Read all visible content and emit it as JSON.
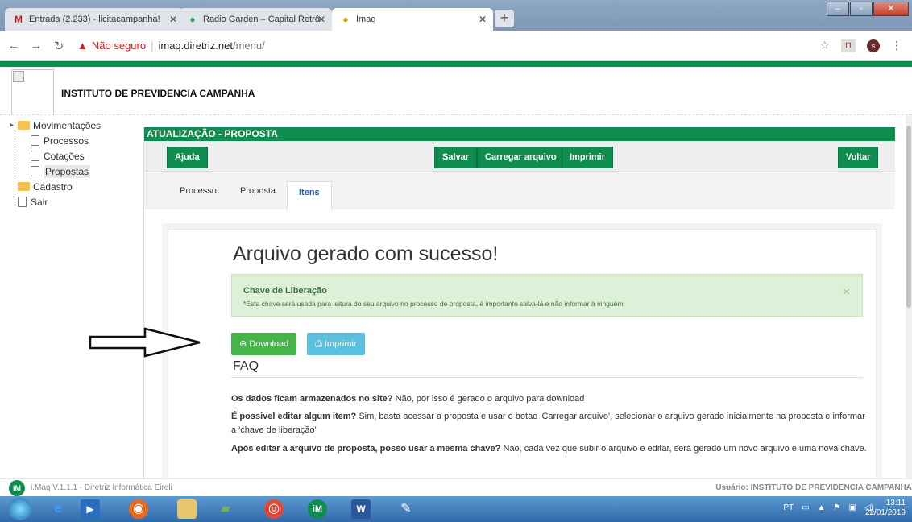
{
  "browser": {
    "tabs": [
      {
        "label": "Entrada (2.233) - licitacampanha!",
        "icon": "gmail-icon"
      },
      {
        "label": "Radio Garden – Capital Retrô",
        "icon": "radio-icon"
      },
      {
        "label": "Imaq",
        "icon": "site-icon"
      }
    ],
    "security_label": "Não seguro",
    "url_host": "imaq.diretriz.net",
    "url_path": "/menu/"
  },
  "header": {
    "institute": "INSTITUTO DE PREVIDENCIA CAMPANHA"
  },
  "tree": {
    "movimentacoes": "Movimentações",
    "processos": "Processos",
    "cotacoes": "Cotações",
    "propostas": "Propostas",
    "cadastro": "Cadastro",
    "sair": "Sair"
  },
  "panel": {
    "title": "ATUALIZAÇÃO - PROPOSTA",
    "buttons": {
      "ajuda": "Ajuda",
      "salvar": "Salvar",
      "carregar": "Carregar arquivo",
      "imprimir": "Imprimir",
      "voltar": "Voltar"
    },
    "tabs": [
      "Processo",
      "Proposta",
      "Itens"
    ]
  },
  "content": {
    "success": "Arquivo gerado com sucesso!",
    "alert_title": "Chave de Liberação",
    "alert_text": "*Esta chave será usada para leitura do seu arquivo no processo de proposta, é importante salva-lá e não informar à ninguém",
    "download": "Download",
    "print": "Imprimir",
    "faq_title": "FAQ",
    "faq": [
      {
        "q": "Os dados ficam armazenados no site?",
        "a": " Não, por isso é gerado o arquivo para download"
      },
      {
        "q": "É possivel editar algum item?",
        "a": " Sim, basta acessar a proposta e usar o botao 'Carregar arquivo', selecionar o arquivo gerado inicialmente na proposta e informar a 'chave de liberação'"
      },
      {
        "q": "Após editar a arquivo de proposta, posso usar a mesma chave?",
        "a": " Não, cada vez que subir o arquivo e editar, será gerado um novo arquivo e uma nova chave."
      }
    ]
  },
  "footer": {
    "version": "i.Maq V.1.1.1 - Diretriz Informática Eireli",
    "user": "Usuário: INSTITUTO DE PREVIDENCIA CAMPANHA"
  },
  "taskbar": {
    "lang": "PT",
    "time": "13:11",
    "date": "22/01/2019"
  }
}
